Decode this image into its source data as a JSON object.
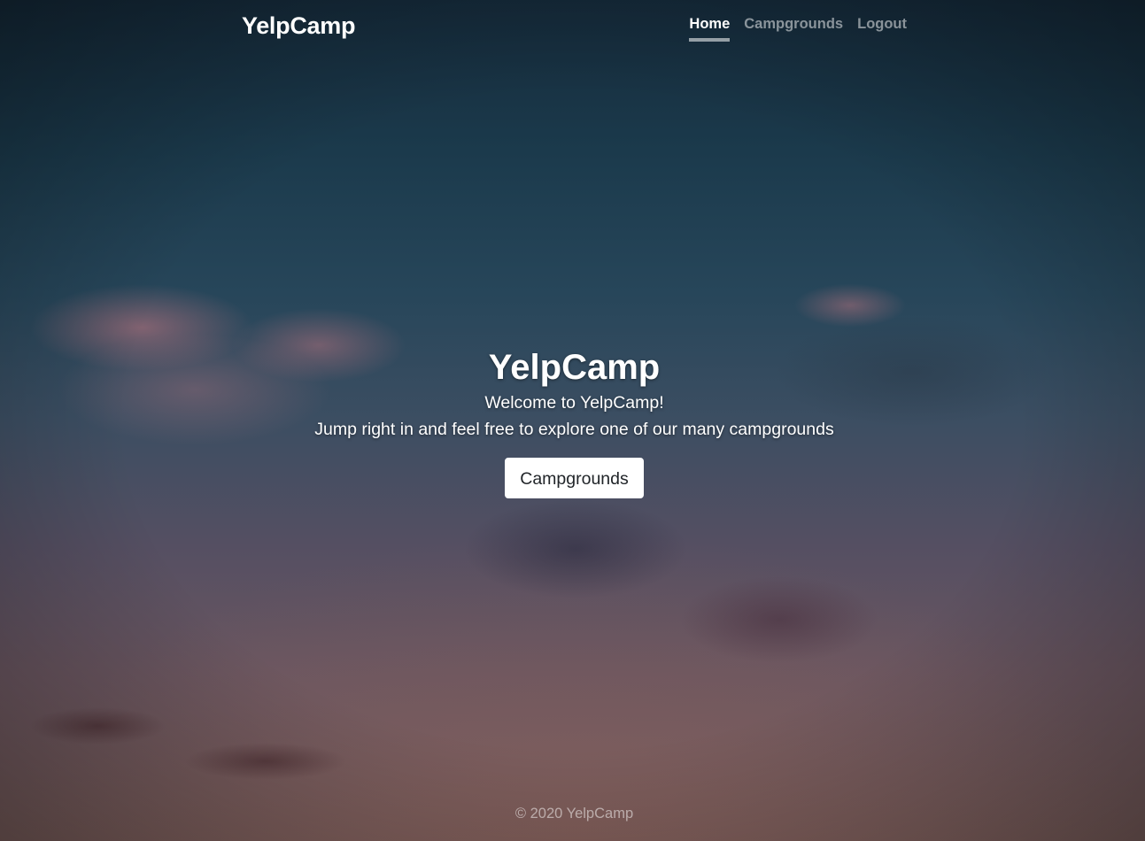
{
  "navbar": {
    "brand": "YelpCamp",
    "links": [
      {
        "label": "Home",
        "active": true
      },
      {
        "label": "Campgrounds",
        "active": false
      },
      {
        "label": "Logout",
        "active": false
      }
    ]
  },
  "hero": {
    "title": "YelpCamp",
    "welcome": "Welcome to YelpCamp!",
    "tagline": "Jump right in and feel free to explore one of our many campgrounds",
    "button_label": "Campgrounds"
  },
  "footer": {
    "text": "© 2020 YelpCamp"
  },
  "colors": {
    "text": "#ffffff",
    "muted_text": "rgba(255,255,255,0.5)",
    "button_bg": "#ffffff",
    "button_text": "#212529"
  }
}
